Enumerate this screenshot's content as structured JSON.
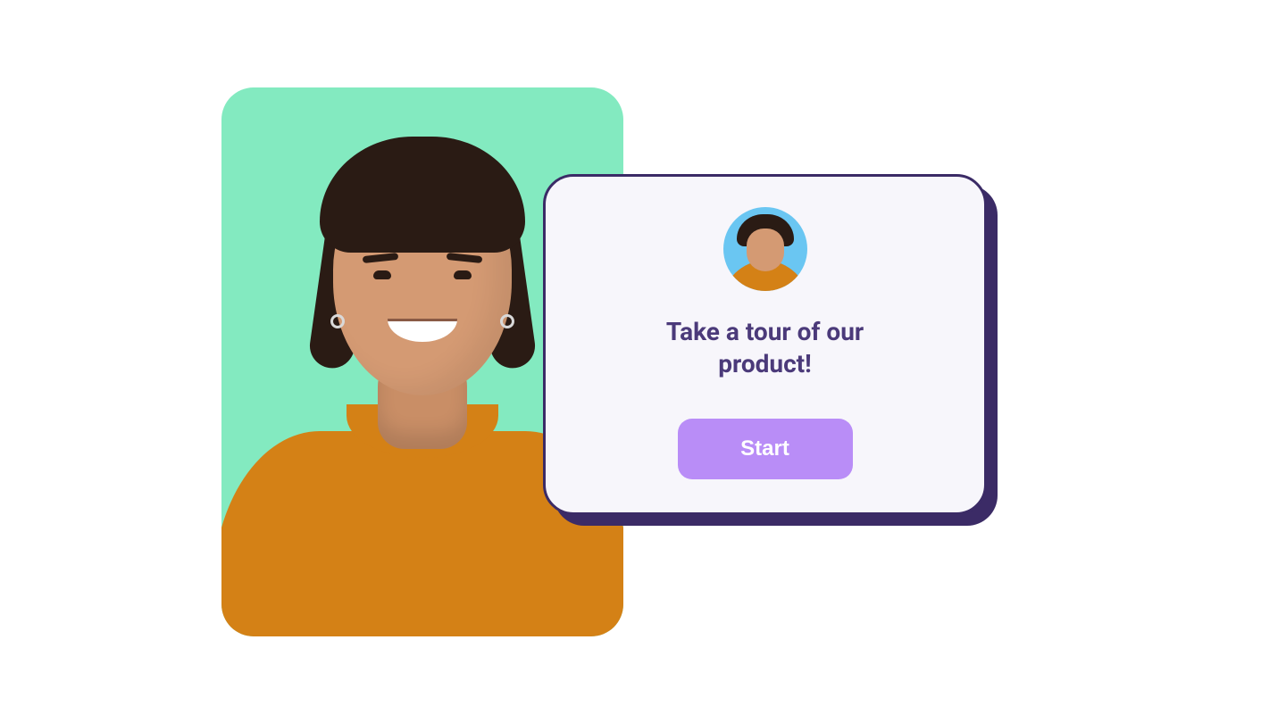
{
  "modal": {
    "title": "Take a tour of our product!",
    "cta_label": "Start"
  },
  "colors": {
    "mint": "#83eac0",
    "card_bg": "#f7f6fb",
    "card_border": "#3b2b66",
    "headline": "#4b3a7a",
    "button_bg": "#b98df7",
    "button_text": "#ffffff",
    "shirt": "#d48116",
    "avatar_bg": "#6ac6f2"
  }
}
